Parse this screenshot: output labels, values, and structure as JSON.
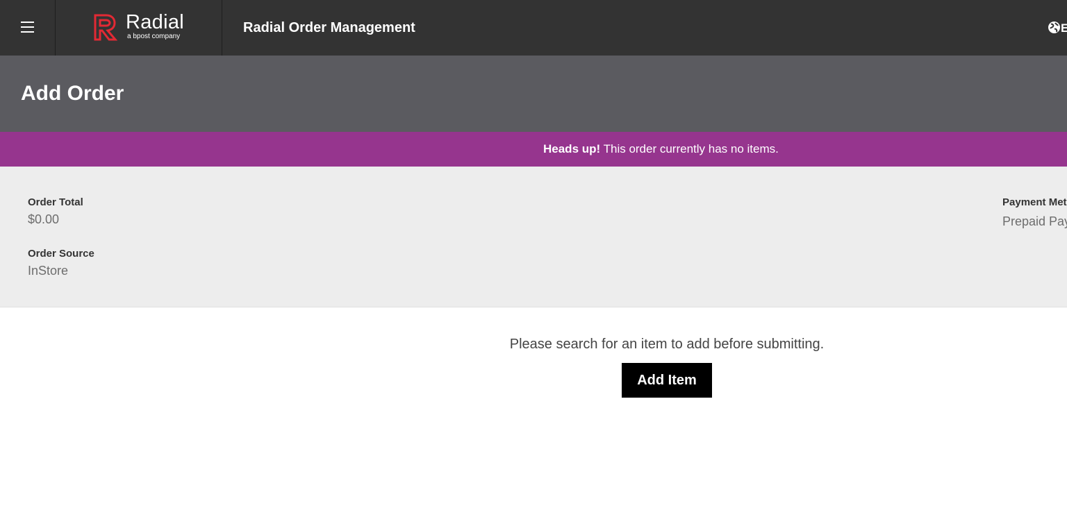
{
  "header": {
    "brand_name": "Radial",
    "brand_tagline": "a bpost company",
    "app_title": "Radial Order Management",
    "locale_partial": "E"
  },
  "page": {
    "title": "Add Order"
  },
  "alert": {
    "strong": "Heads up!",
    "message": " This order currently has no items."
  },
  "summary": {
    "order_total_label": "Order Total",
    "order_total_value": "$0.00",
    "order_source_label": "Order Source",
    "order_source_value": "InStore",
    "payment_method_label": "Payment Met",
    "payment_method_value": "Prepaid Pay"
  },
  "main": {
    "hint": "Please search for an item to add before submitting.",
    "add_item_label": "Add Item"
  },
  "colors": {
    "topbar": "#333333",
    "page_header": "#5b5b60",
    "alert": "#96358e",
    "logo_red": "#e32934",
    "summary_bg": "#ededed",
    "button": "#000000"
  }
}
